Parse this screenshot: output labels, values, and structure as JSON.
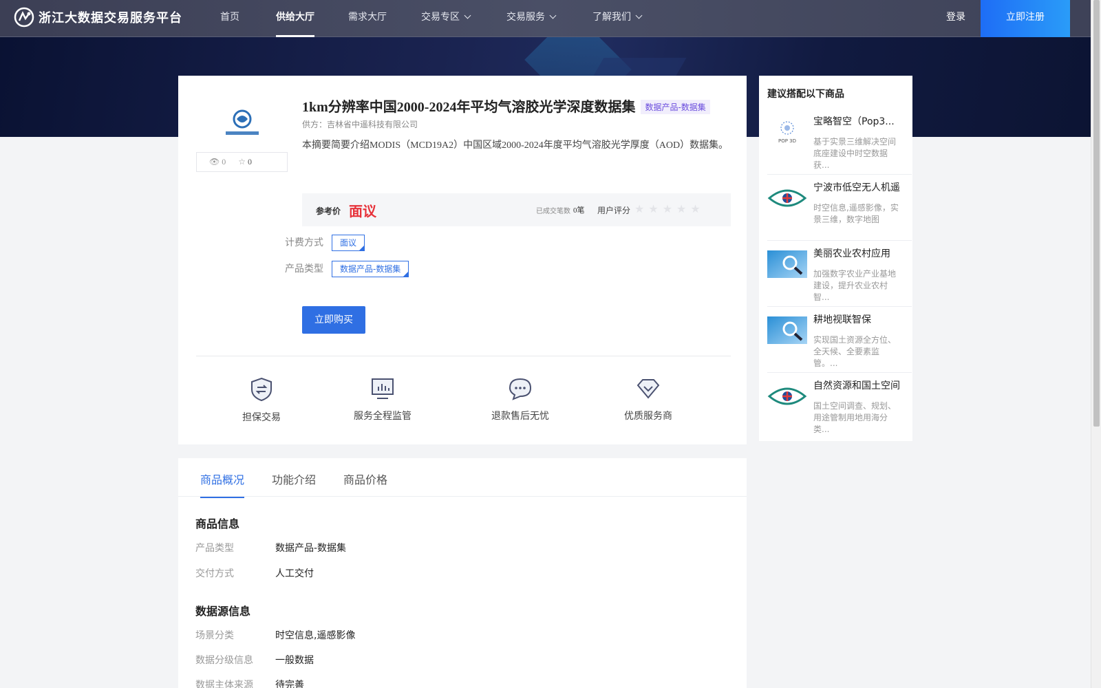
{
  "header": {
    "logo_text": "浙江大数据交易服务平台",
    "nav": [
      {
        "label": "首页",
        "dropdown": false,
        "active": false
      },
      {
        "label": "供给大厅",
        "dropdown": false,
        "active": true
      },
      {
        "label": "需求大厅",
        "dropdown": false,
        "active": false
      },
      {
        "label": "交易专区",
        "dropdown": true,
        "active": false
      },
      {
        "label": "交易服务",
        "dropdown": true,
        "active": false
      },
      {
        "label": "了解我们",
        "dropdown": true,
        "active": false
      }
    ],
    "login_label": "登录",
    "register_label": "立即注册"
  },
  "product": {
    "title": "1km分辨率中国2000-2024年平均气溶胶光学深度数据集",
    "title_tag": "数据产品-数据集",
    "supplier": "供方：吉林省中遥科技有限公司",
    "description": "本摘要简要介绍MODIS（MCD19A2）中国区域2000-2024年度平均气溶胶光学厚度（AOD）数据集。",
    "views": "0",
    "favorites": "0",
    "price_label": "参考价",
    "price_value": "面议",
    "deal_label": "已成交笔数",
    "deal_count": "0笔",
    "rating_label": "用户评分",
    "rating_stars": 0,
    "rating_max": 5,
    "billing_label": "计费方式",
    "billing_value": "面议",
    "type_label": "产品类型",
    "type_value": "数据产品-数据集",
    "buy_label": "立即购买"
  },
  "features": [
    {
      "label": "担保交易",
      "icon": "shield-exchange-icon"
    },
    {
      "label": "服务全程监管",
      "icon": "monitor-chart-icon"
    },
    {
      "label": "退款售后无忧",
      "icon": "chat-bubble-icon"
    },
    {
      "label": "优质服务商",
      "icon": "diamond-icon"
    }
  ],
  "tabs": [
    {
      "label": "商品概况",
      "active": true
    },
    {
      "label": "功能介绍",
      "active": false
    },
    {
      "label": "商品价格",
      "active": false
    }
  ],
  "overview": {
    "product_info_title": "商品信息",
    "product_info": [
      {
        "key": "产品类型",
        "value": "数据产品-数据集"
      },
      {
        "key": "交付方式",
        "value": "人工交付"
      }
    ],
    "source_info_title": "数据源信息",
    "source_info": [
      {
        "key": "场景分类",
        "value": "时空信息,遥感影像"
      },
      {
        "key": "数据分级信息",
        "value": "一般数据"
      },
      {
        "key": "数据主体来源",
        "value": "待完善"
      }
    ]
  },
  "sidebar": {
    "title": "建议搭配以下商品",
    "items": [
      {
        "name": "宝略智空（Pop3...",
        "desc": "基于实景三维解决空间底座建设中时空数据获...",
        "thumb": "pop3d-logo",
        "thumb_text": "POP 3D"
      },
      {
        "name": "宁波市低空无人机遥",
        "desc": "时空信息,遥感影像，实景三维，数字地图",
        "thumb": "eye-logo"
      },
      {
        "name": "美丽农业农村应用",
        "desc": "加强数字农业产业基地建设，提升农业农村智...",
        "thumb": "magnifier-photo"
      },
      {
        "name": "耕地视联智保",
        "desc": "实现国土资源全方位、全天候、全要素监管。...",
        "thumb": "magnifier-photo"
      },
      {
        "name": "自然资源和国土空间",
        "desc": "国土空间调查、规划、用途管制用地用海分类...",
        "thumb": "eye-logo"
      }
    ]
  },
  "colors": {
    "accent": "#2f6fe3",
    "price": "#e7323a",
    "header_bg": "#44485e"
  }
}
